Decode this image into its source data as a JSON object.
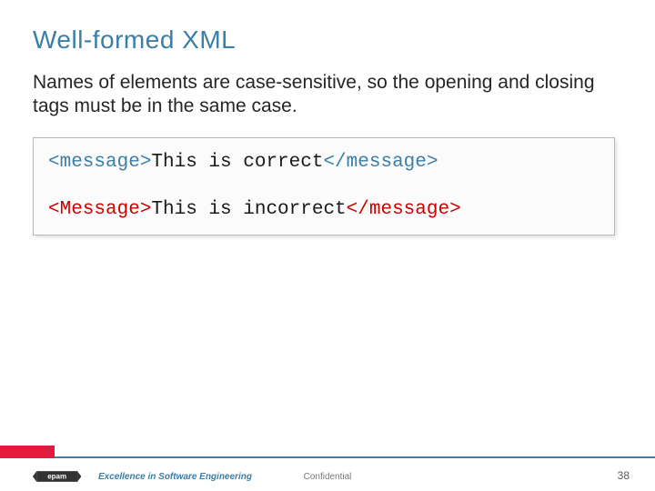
{
  "title": "Well-formed XML",
  "body": "Names of elements are case-sensitive, so the opening and closing tags must be in the same case.",
  "code": {
    "line1": {
      "open": "<message>",
      "text": "This is correct",
      "close": "</message>"
    },
    "line2": {
      "open": "<Message>",
      "text": "This is incorrect",
      "close": "</message>"
    }
  },
  "footer": {
    "logo_text": "epam",
    "tagline": "Excellence in Software Engineering",
    "confidential": "Confidential",
    "page": "38"
  }
}
